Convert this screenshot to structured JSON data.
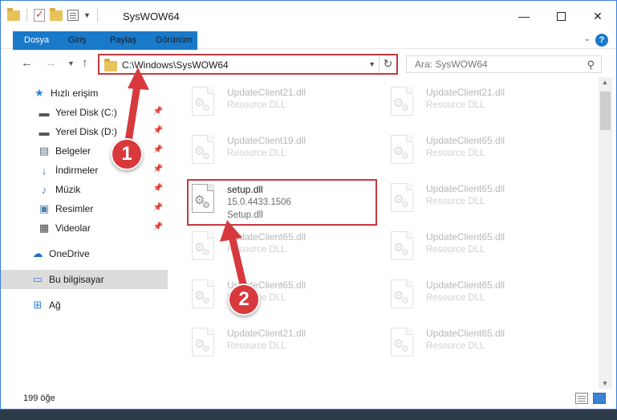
{
  "window": {
    "title": "SysWOW64"
  },
  "ribbon": {
    "tabs": [
      "Dosya",
      "Giriş",
      "Paylaş",
      "Görünüm"
    ]
  },
  "nav": {
    "address": "C:\\Windows\\SysWOW64",
    "search_placeholder": "Ara: SysWOW64"
  },
  "sidebar": {
    "items": [
      {
        "label": "Hızlı erişim",
        "icon": "star-icon"
      },
      {
        "label": "Yerel Disk (C:)",
        "icon": "drive-icon",
        "pinned": true
      },
      {
        "label": "Yerel Disk (D:)",
        "icon": "drive-icon",
        "pinned": true
      },
      {
        "label": "Belgeler",
        "icon": "documents-icon",
        "pinned": true
      },
      {
        "label": "İndirmeler",
        "icon": "download-icon",
        "pinned": true
      },
      {
        "label": "Müzik",
        "icon": "music-icon",
        "pinned": true
      },
      {
        "label": "Resimler",
        "icon": "pictures-icon",
        "pinned": true
      },
      {
        "label": "Videolar",
        "icon": "videos-icon",
        "pinned": true
      },
      {
        "label": "OneDrive",
        "icon": "cloud-icon"
      },
      {
        "label": "Bu bilgisayar",
        "icon": "computer-icon",
        "selected": true
      },
      {
        "label": "Ağ",
        "icon": "network-icon"
      }
    ]
  },
  "files": {
    "col1": [
      {
        "name": "UpdateClient21.dll",
        "line2": "Resource DLL",
        "line3": "",
        "faded": true
      },
      {
        "name": "UpdateClient19.dll",
        "line2": "Resource DLL",
        "line3": "",
        "faded": true
      },
      {
        "name": "setup.dll",
        "line2": "15.0.4433.1506",
        "line3": "Setup.dll",
        "faded": false
      },
      {
        "name": "UpdateClient65.dll",
        "line2": "Resource DLL",
        "line3": "",
        "faded": true
      },
      {
        "name": "UpdateClient65.dll",
        "line2": "Resource DLL",
        "line3": "",
        "faded": true
      },
      {
        "name": "UpdateClient21.dll",
        "line2": "Resource DLL",
        "line3": "",
        "faded": true
      }
    ],
    "col2": [
      {
        "name": "UpdateClient21.dll",
        "line2": "Resource DLL",
        "line3": "",
        "faded": true
      },
      {
        "name": "UpdateClient65.dll",
        "line2": "Resource DLL",
        "line3": "",
        "faded": true
      },
      {
        "name": "UpdateClient65.dll",
        "line2": "Resource DLL",
        "line3": "",
        "faded": true
      },
      {
        "name": "UpdateClient65.dll",
        "line2": "Resource DLL",
        "line3": "",
        "faded": true
      },
      {
        "name": "UpdateClient65.dll",
        "line2": "Resource DLL",
        "line3": "",
        "faded": true
      },
      {
        "name": "UpdateClient65.dll",
        "line2": "Resource DLL",
        "line3": "",
        "faded": true
      }
    ]
  },
  "status": {
    "count": "199 öğe"
  },
  "annotations": {
    "step1": "1",
    "step2": "2"
  },
  "colors": {
    "accent": "#1979ca",
    "highlight": "#c9383d"
  }
}
